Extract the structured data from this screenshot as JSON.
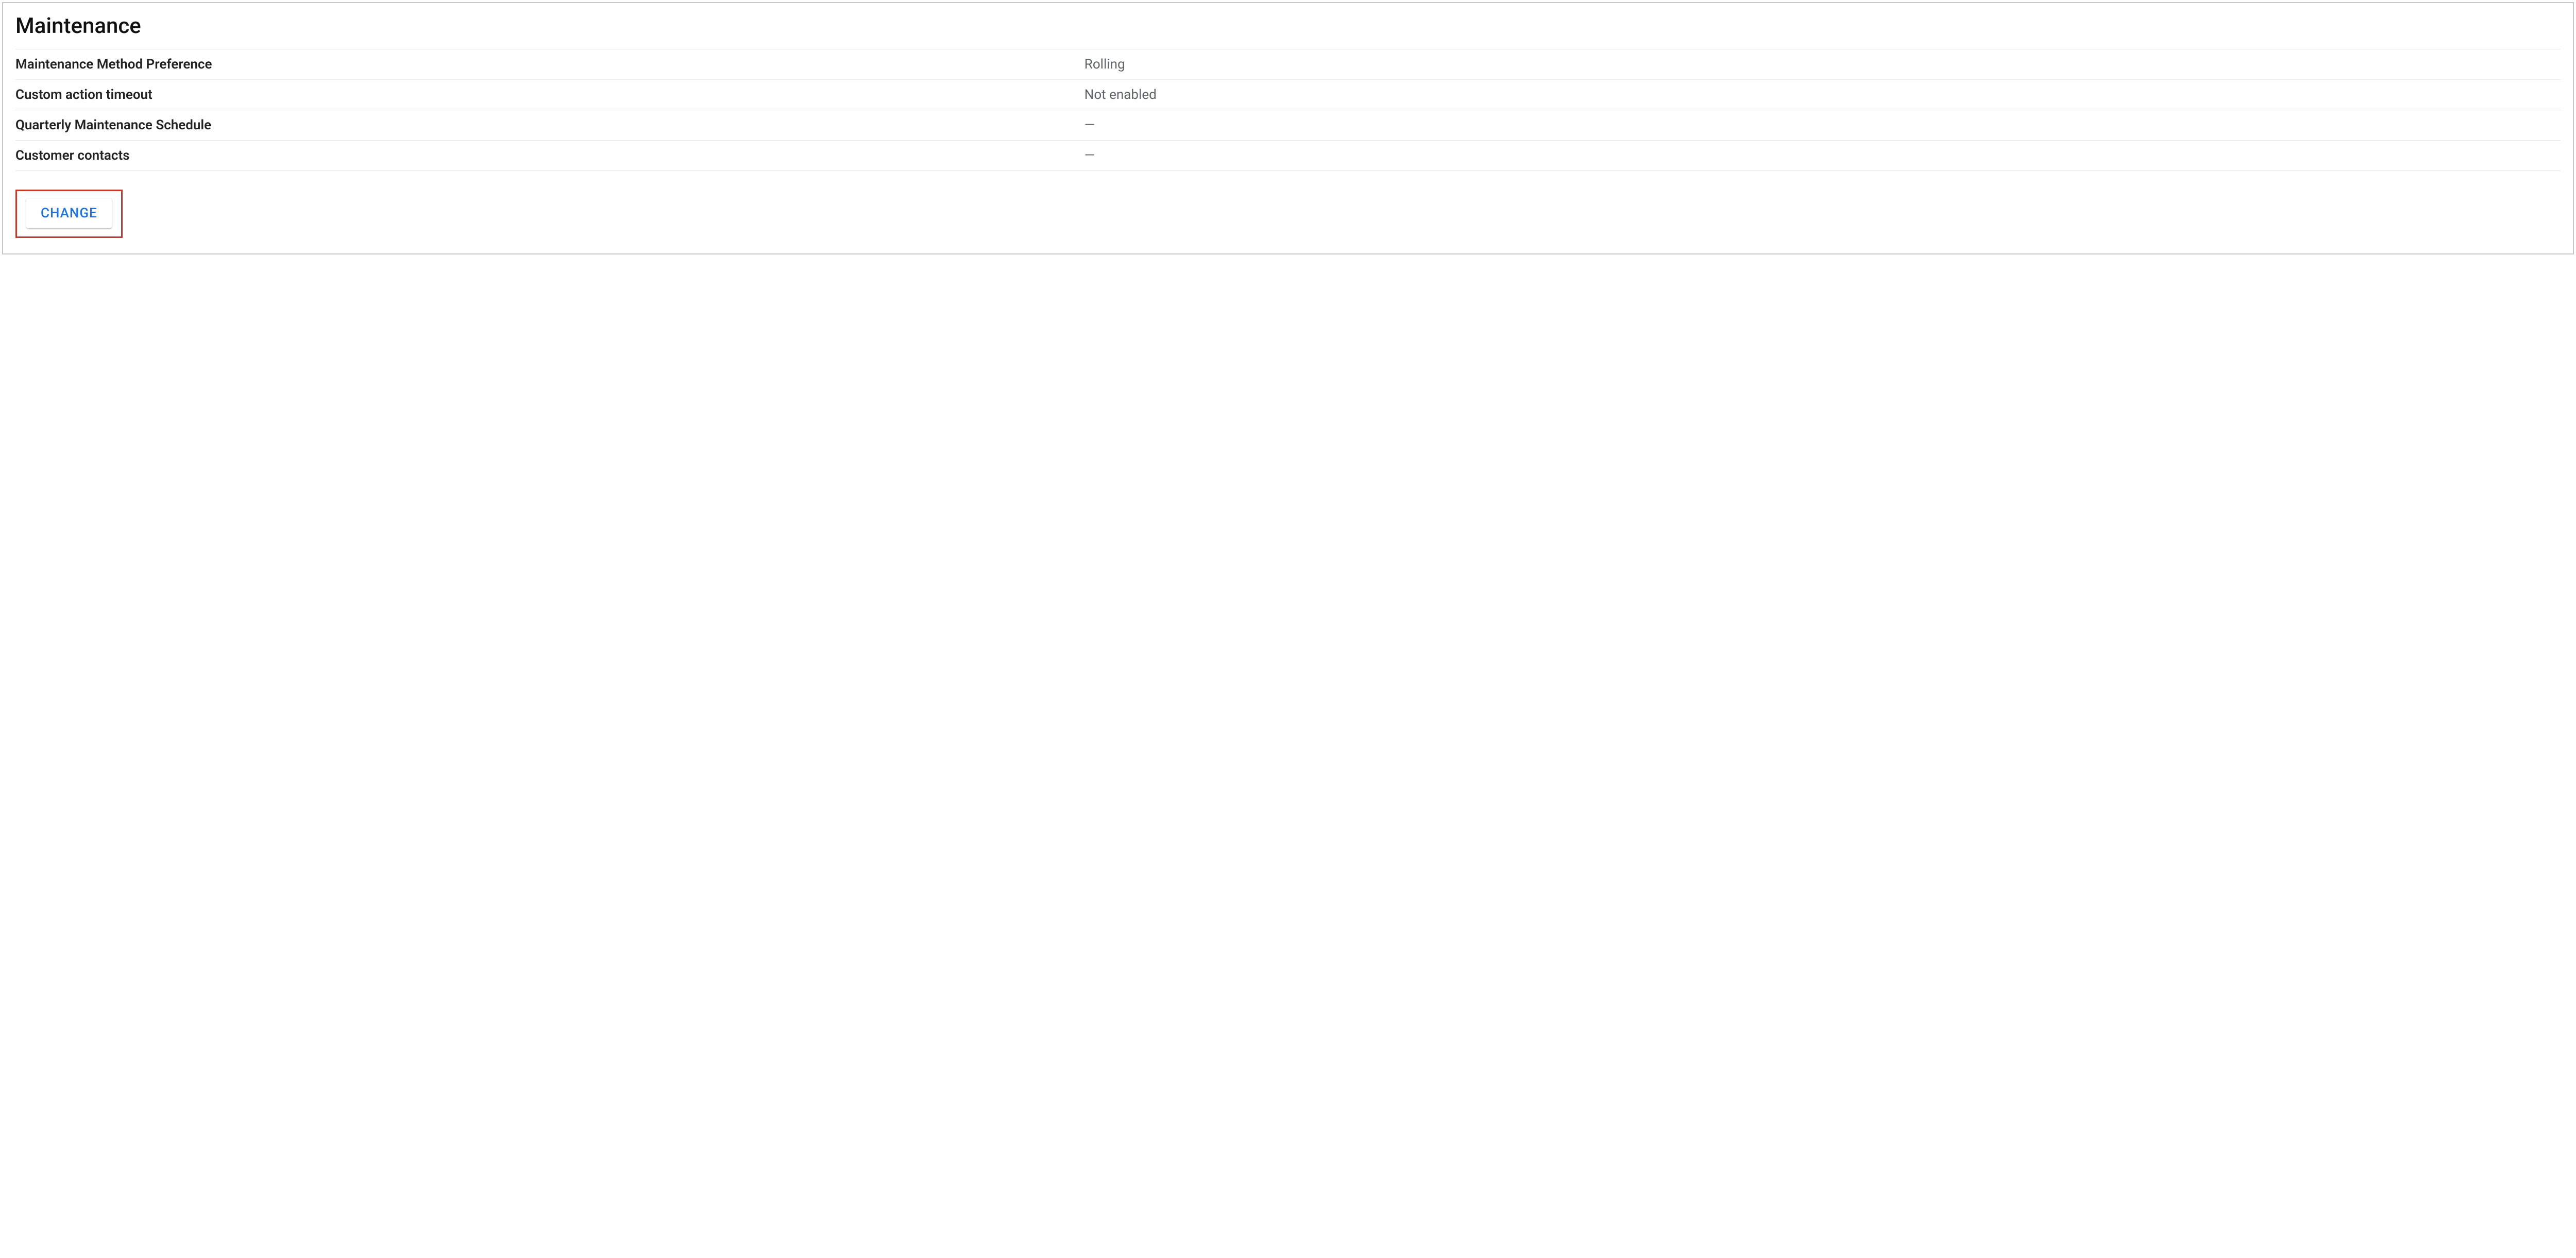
{
  "section": {
    "title": "Maintenance",
    "rows": [
      {
        "label": "Maintenance Method Preference",
        "value": "Rolling"
      },
      {
        "label": "Custom action timeout",
        "value": "Not enabled"
      },
      {
        "label": "Quarterly Maintenance Schedule",
        "value": "—"
      },
      {
        "label": "Customer contacts",
        "value": "—"
      }
    ],
    "change_button_label": "CHANGE"
  }
}
